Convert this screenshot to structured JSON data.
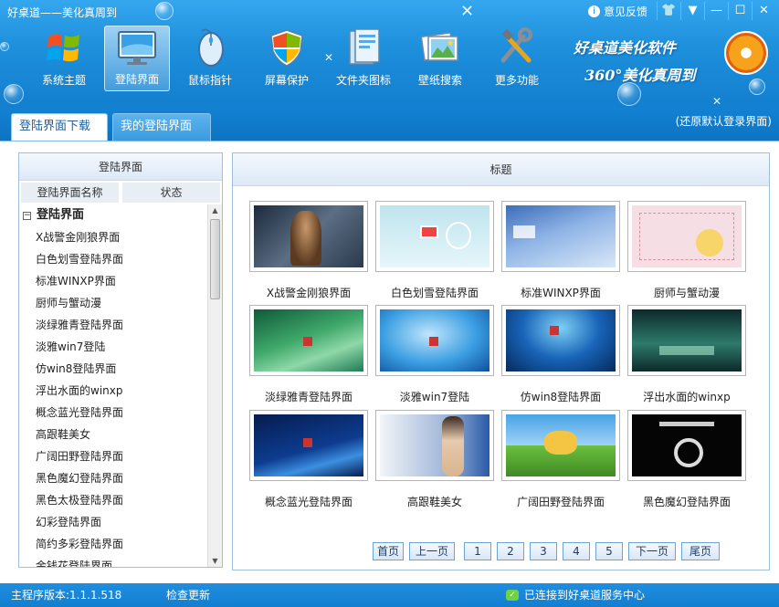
{
  "window": {
    "title": "好桌道——美化真周到",
    "feedback_label": "意见反馈",
    "controls": [
      "shirt-icon",
      "menu-icon",
      "minimize-icon",
      "maximize-icon",
      "close-icon"
    ]
  },
  "toolbar": {
    "items": [
      {
        "label": "系统主题",
        "icon": "windows-flag-icon",
        "active": false
      },
      {
        "label": "登陆界面",
        "icon": "monitor-icon",
        "active": true
      },
      {
        "label": "鼠标指针",
        "icon": "mouse-icon",
        "active": false
      },
      {
        "label": "屏幕保护",
        "icon": "shield-icon",
        "active": false
      },
      {
        "label": "文件夹图标",
        "icon": "folder-icon",
        "active": false
      },
      {
        "label": "壁纸搜索",
        "icon": "picture-icon",
        "active": false
      },
      {
        "label": "更多功能",
        "icon": "tools-icon",
        "active": false
      }
    ]
  },
  "brand": {
    "line1": "好桌道美化软件",
    "line2": "360°美化真周到"
  },
  "tabs": {
    "items": [
      "登陆界面下载",
      "我的登陆界面"
    ],
    "active_index": 0,
    "restore_label": "(还原默认登录界面)"
  },
  "left_panel": {
    "header": "登陆界面",
    "columns": [
      "登陆界面名称",
      "状态"
    ],
    "tree_root": "登陆界面",
    "items": [
      "X战警金刚狼界面",
      "白色划雪登陆界面",
      "标准WINXP界面",
      "厨师与蟹动漫",
      "淡绿雅青登陆界面",
      "淡雅win7登陆",
      "仿win8登陆界面",
      "浮出水面的winxp",
      "概念蓝光登陆界面",
      "高跟鞋美女",
      "广阔田野登陆界面",
      "黑色魔幻登陆界面",
      "黑色太极登陆界面",
      "幻彩登陆界面",
      "简约多彩登陆界面",
      "金钱花登陆界面"
    ]
  },
  "right_panel": {
    "header": "标题",
    "thumbnails": [
      {
        "caption": "X战警金刚狼界面",
        "style": "wolverine"
      },
      {
        "caption": "白色划雪登陆界面",
        "style": "snow"
      },
      {
        "caption": "标准WINXP界面",
        "style": "xp"
      },
      {
        "caption": "厨师与蟹动漫",
        "style": "cartoon"
      },
      {
        "caption": "淡绿雅青登陆界面",
        "style": "green"
      },
      {
        "caption": "淡雅win7登陆",
        "style": "win7"
      },
      {
        "caption": "仿win8登陆界面",
        "style": "win8"
      },
      {
        "caption": "浮出水面的winxp",
        "style": "underwater"
      },
      {
        "caption": "概念蓝光登陆界面",
        "style": "bluelight"
      },
      {
        "caption": "高跟鞋美女",
        "style": "heels"
      },
      {
        "caption": "广阔田野登陆界面",
        "style": "field"
      },
      {
        "caption": "黑色魔幻登陆界面",
        "style": "dark"
      }
    ]
  },
  "pager": {
    "buttons": [
      "首页",
      "上一页",
      "1",
      "2",
      "3",
      "4",
      "5",
      "下一页",
      "尾页"
    ]
  },
  "status": {
    "version": "主程序版本:1.1.1.518",
    "check_update": "检查更新",
    "connection": "已连接到好桌道服务中心"
  }
}
